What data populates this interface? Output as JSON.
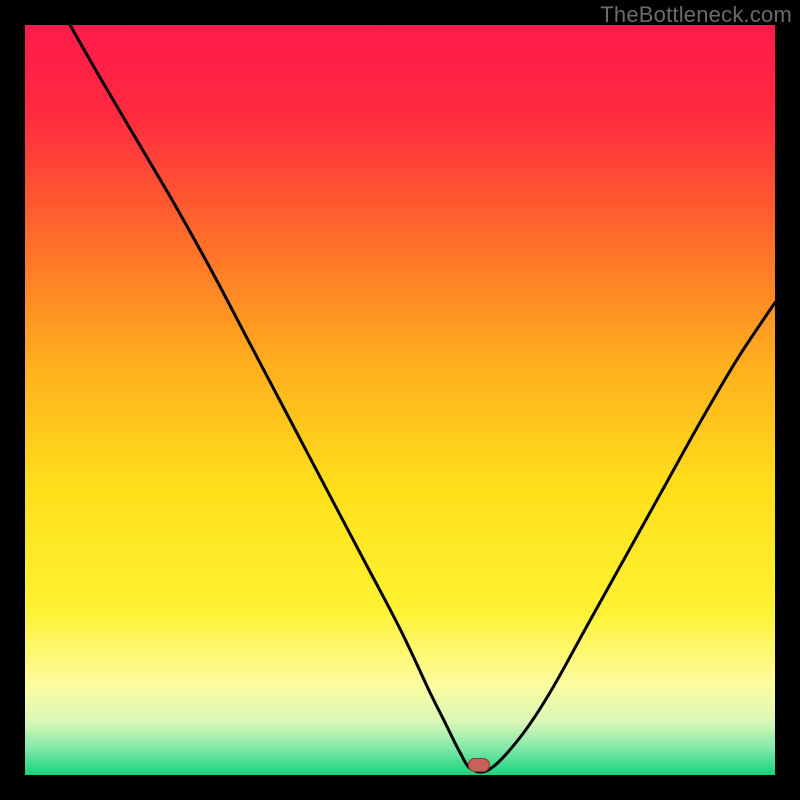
{
  "watermark": "TheBottleneck.com",
  "colors": {
    "frame": "#000000",
    "gradient_stops": [
      {
        "pos": 0.0,
        "color": "#ff1a4b"
      },
      {
        "pos": 0.12,
        "color": "#ff2a3f"
      },
      {
        "pos": 0.28,
        "color": "#ff6a2a"
      },
      {
        "pos": 0.45,
        "color": "#ffae1e"
      },
      {
        "pos": 0.62,
        "color": "#ffe01a"
      },
      {
        "pos": 0.78,
        "color": "#fff232"
      },
      {
        "pos": 0.88,
        "color": "#fdfca0"
      },
      {
        "pos": 0.93,
        "color": "#d8f7b8"
      },
      {
        "pos": 0.965,
        "color": "#7fe8a8"
      },
      {
        "pos": 1.0,
        "color": "#17d37a"
      }
    ],
    "curve": "#000000",
    "marker_fill": "#c9605a",
    "marker_stroke": "#8a3d38"
  },
  "chart_data": {
    "type": "line",
    "title": "",
    "xlabel": "",
    "ylabel": "",
    "xlim": [
      0,
      100
    ],
    "ylim": [
      0,
      100
    ],
    "series": [
      {
        "name": "bottleneck-curve",
        "x": [
          6,
          10,
          15,
          20,
          25,
          30,
          35,
          40,
          45,
          50,
          54,
          56,
          58,
          59.5,
          62,
          66,
          70,
          75,
          80,
          85,
          90,
          95,
          100
        ],
        "y": [
          100,
          93,
          84.5,
          76,
          67,
          57.5,
          48,
          38.5,
          29,
          19.5,
          11,
          7,
          3,
          0.8,
          0.8,
          5,
          11,
          20,
          29,
          38,
          47,
          55.5,
          63
        ]
      }
    ],
    "flat_segment": {
      "x0": 56.5,
      "x1": 62,
      "y": 0.8
    },
    "marker": {
      "x": 60.5,
      "y": 1.4
    }
  }
}
